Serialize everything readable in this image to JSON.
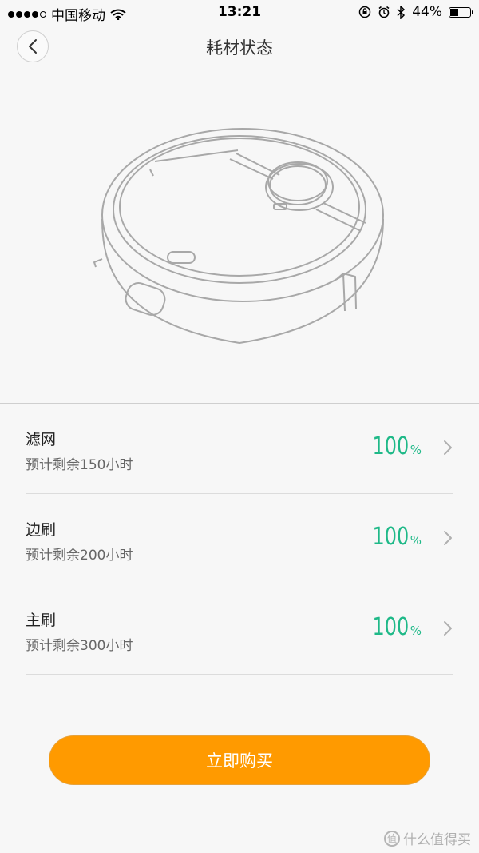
{
  "status_bar": {
    "carrier": "中国移动",
    "time": "13:21",
    "battery": "44%",
    "battery_level": 0.44
  },
  "header": {
    "title": "耗材状态"
  },
  "consumables": [
    {
      "name": "滤网",
      "remaining": "预计剩余150小时",
      "percent": "100",
      "percent_unit": "%"
    },
    {
      "name": "边刷",
      "remaining": "预计剩余200小时",
      "percent": "100",
      "percent_unit": "%"
    },
    {
      "name": "主刷",
      "remaining": "预计剩余300小时",
      "percent": "100",
      "percent_unit": "%"
    }
  ],
  "buy_button": {
    "label": "立即购买"
  },
  "watermark": {
    "text": "什么值得买",
    "icon": "值"
  },
  "colors": {
    "accent_green": "#1fb988",
    "buy_orange": "#ff9a00",
    "background": "#f7f7f7"
  }
}
